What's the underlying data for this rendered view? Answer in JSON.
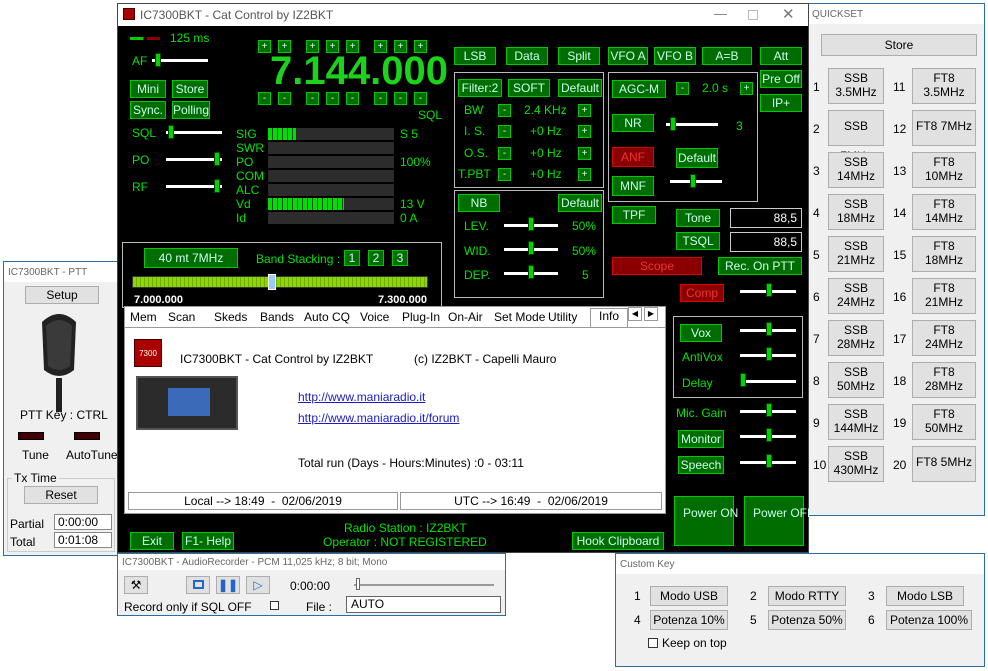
{
  "main": {
    "title": "IC7300BKT - Cat Control by IZ2BKT",
    "timer": "125 ms",
    "af": "AF",
    "frequency": "7.144.000",
    "sql_label": "SQL",
    "mini": "Mini",
    "store": "Store",
    "sync": "Sync.",
    "polling": "Polling",
    "sql": "SQL",
    "po": "PO",
    "rf": "RF",
    "meters": [
      {
        "name": "SIG",
        "value": "S 5",
        "level": 0.22
      },
      {
        "name": "SWR",
        "value": "",
        "level": 0
      },
      {
        "name": "PO",
        "value": "100%",
        "level": 0
      },
      {
        "name": "COM",
        "value": "",
        "level": 0
      },
      {
        "name": "ALC",
        "value": "",
        "level": 0
      },
      {
        "name": "Vd",
        "value": "13 V",
        "level": 0.6
      },
      {
        "name": "Id",
        "value": "0 A",
        "level": 0
      }
    ],
    "mode_buttons": [
      "LSB",
      "Data",
      "Split",
      "VFO A",
      "VFO B",
      "A=B",
      "Att"
    ],
    "filter": "Filter:2",
    "soft": "SOFT",
    "default": "Default",
    "bw": "BW",
    "bw_val": "2.4 KHz",
    "is": "I. S.",
    "is_val": "+0 Hz",
    "os": "O.S.",
    "os_val": "+0 Hz",
    "tpbt": "T.PBT",
    "tpbt_val": "+0 Hz",
    "agc": "AGC-M",
    "agc_val": "2.0 s",
    "pre": "Pre Off",
    "ip": "IP+",
    "nr": "NR",
    "nr_val": "3",
    "anf": "ANF",
    "default2": "Default",
    "mnf": "MNF",
    "nb": "NB",
    "nb_default": "Default",
    "lev": "LEV.",
    "lev_val": "50%",
    "wid": "WID.",
    "wid_val": "50%",
    "dep": "DEP.",
    "dep_val": "5",
    "tpf": "TPF",
    "tone": "Tone",
    "tone_val": "88,5",
    "tsql": "TSQL",
    "tsql_val": "88,5",
    "scope": "Scope",
    "rec_ptt": "Rec. On PTT",
    "comp": "Comp",
    "band": "40 mt 7MHz",
    "band_stacking": "Band Stacking :",
    "stacks": [
      "1",
      "2",
      "3"
    ],
    "scale_lo": "7.000.000",
    "scale_hi": "7.300.000",
    "tabs": [
      "Mem",
      "Scan",
      "Skeds",
      "Bands",
      "Auto CQ",
      "Voice",
      "Plug-In",
      "On-Air",
      "Set Mode",
      "Utility",
      "Info"
    ],
    "info_title": "IC7300BKT - Cat Control by IZ2BKT",
    "info_copy": "(c) IZ2BKT - Capelli Mauro",
    "link1": "http://www.maniaradio.it",
    "link2": "http://www.maniaradio.it/forum",
    "total_run": "Total run (Days - Hours:Minutes) :0 - 03:11",
    "local": "Local --> 18:49  -  02/06/2019",
    "utc": "UTC --> 16:49  -  02/06/2019",
    "vox": "Vox",
    "antivox": "AntiVox",
    "delay": "Delay",
    "mic_gain": "Mic. Gain",
    "monitor": "Monitor",
    "speech": "Speech",
    "power_on": "Power ON",
    "power_off": "Power OFF",
    "exit": "Exit",
    "help": "F1- Help",
    "station": "Radio Station : IZ2BKT",
    "operator": "Operator : NOT REGISTERED",
    "hook": "Hook Clipboard"
  },
  "ptt": {
    "title": "IC7300BKT - PTT",
    "setup": "Setup",
    "key": "PTT Key : CTRL",
    "tune": "Tune",
    "autotune": "AutoTune",
    "txtime": "Tx Time",
    "reset": "Reset",
    "partial": "Partial",
    "partial_val": "0:00:00",
    "total": "Total",
    "total_val": "0:01:08"
  },
  "quick": {
    "title": "QUICKSET",
    "store": "Store",
    "left": [
      [
        "1",
        "SSB 3.5MHz"
      ],
      [
        "2",
        "SSB 7MHz"
      ],
      [
        "3",
        "SSB 14MHz"
      ],
      [
        "4",
        "SSB 18MHz"
      ],
      [
        "5",
        "SSB 21MHz"
      ],
      [
        "6",
        "SSB 24MHz"
      ],
      [
        "7",
        "SSB 28MHz"
      ],
      [
        "8",
        "SSB 50MHz"
      ],
      [
        "9",
        "SSB 144MHz"
      ],
      [
        "10",
        "SSB 430MHz"
      ]
    ],
    "right": [
      [
        "11",
        "FT8 3.5MHz"
      ],
      [
        "12",
        "FT8 7MHz"
      ],
      [
        "13",
        "FT8 10MHz"
      ],
      [
        "14",
        "FT8 14MHz"
      ],
      [
        "15",
        "FT8 18MHz"
      ],
      [
        "16",
        "FT8 21MHz"
      ],
      [
        "17",
        "FT8 24MHz"
      ],
      [
        "18",
        "FT8 28MHz"
      ],
      [
        "19",
        "FT8 50MHz"
      ],
      [
        "20",
        "FT8 5MHz"
      ]
    ]
  },
  "audio": {
    "title": "IC7300BKT - AudioRecorder - PCM 11,025 kHz; 8 bit; Mono",
    "time": "0:00:00",
    "record_only": "Record only if SQL OFF",
    "file": "File :",
    "file_val": "AUTO"
  },
  "custom": {
    "title": "Custom Key",
    "keys": [
      [
        "1",
        "Modo USB"
      ],
      [
        "2",
        "Modo RTTY"
      ],
      [
        "3",
        "Modo LSB"
      ],
      [
        "4",
        "Potenza 10%"
      ],
      [
        "5",
        "Potenza 50%"
      ],
      [
        "6",
        "Potenza 100%"
      ]
    ],
    "keep": "Keep on top"
  }
}
